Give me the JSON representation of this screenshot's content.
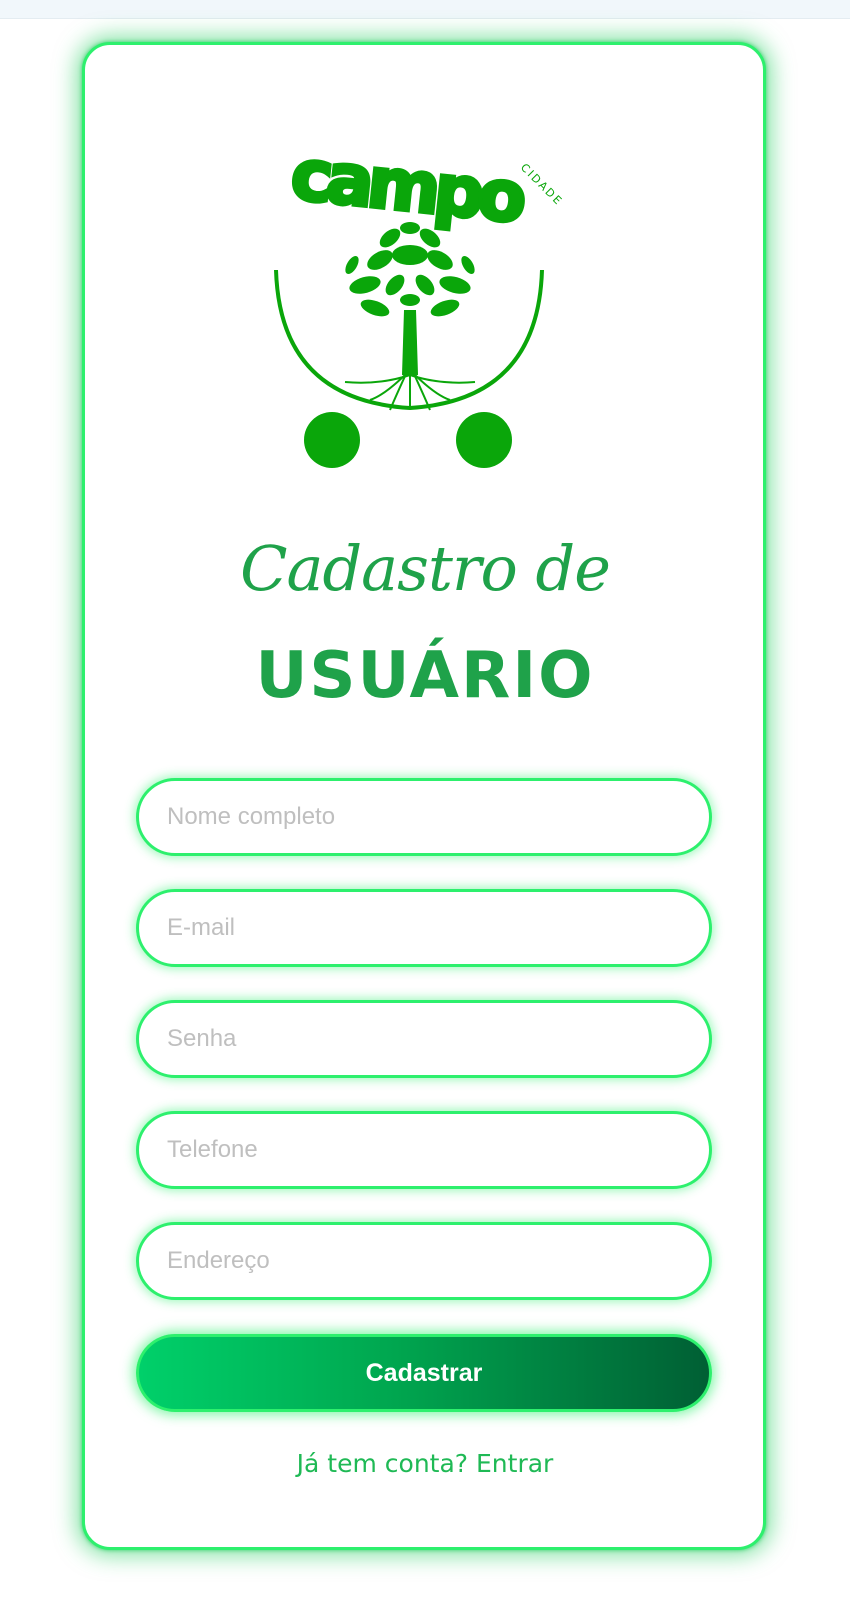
{
  "brand": {
    "logo_word": "campo",
    "logo_subword": "CIDADE",
    "color": "#0aa60a"
  },
  "heading": {
    "line1": "Cadastro de",
    "line2": "USUÁRIO"
  },
  "form": {
    "fields": [
      {
        "placeholder": "Nome completo",
        "value": ""
      },
      {
        "placeholder": "E-mail",
        "value": ""
      },
      {
        "placeholder": "Senha",
        "value": ""
      },
      {
        "placeholder": "Telefone",
        "value": ""
      },
      {
        "placeholder": "Endereço",
        "value": ""
      }
    ],
    "submit_label": "Cadastrar"
  },
  "footer": {
    "login_link": "Já tem conta? Entrar"
  },
  "colors": {
    "accent": "#2df06d",
    "title": "#1fa24a",
    "button_start": "#00d06a",
    "button_end": "#005f34"
  }
}
